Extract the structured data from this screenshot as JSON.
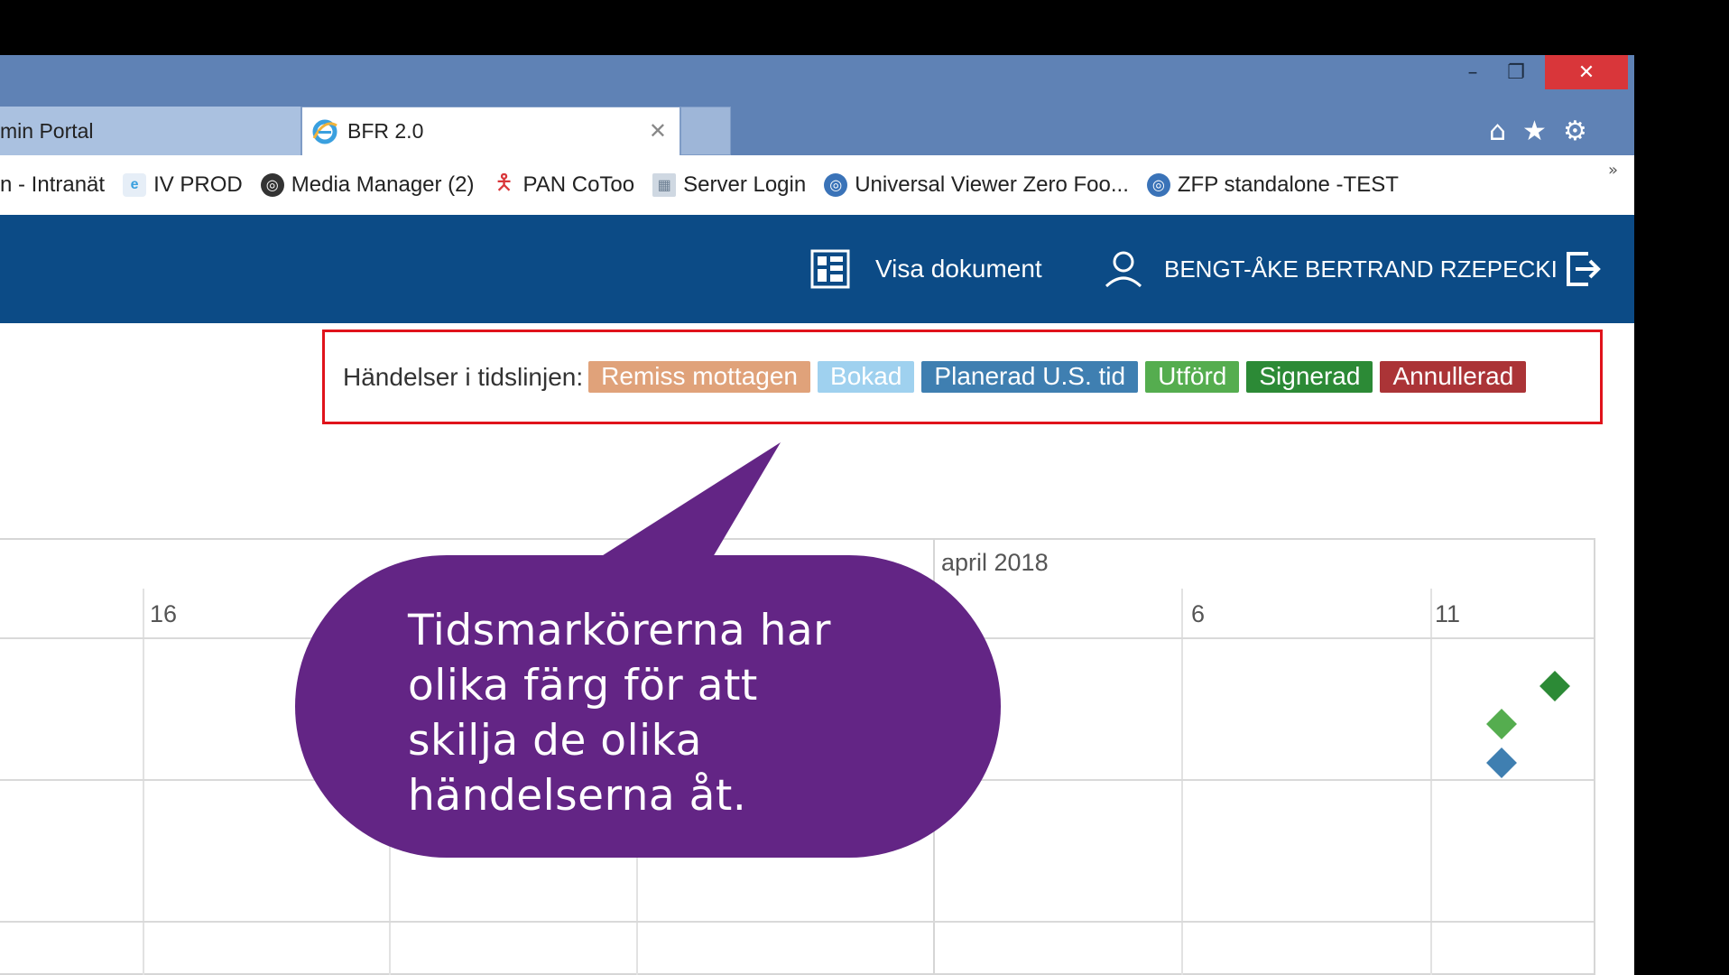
{
  "browser": {
    "tabs": [
      {
        "label": "min Portal",
        "active": false
      },
      {
        "label": "BFR 2.0",
        "active": true
      }
    ],
    "close_tab_glyph": "✕",
    "window_controls": {
      "minimize": "–",
      "restore": "❐",
      "close": "✕"
    },
    "toolbar_icons": {
      "home": "⌂",
      "favorites": "★",
      "settings": "⚙"
    },
    "favorites": [
      {
        "label": "n - Intranät",
        "icon": "none"
      },
      {
        "label": "IV PROD",
        "icon": "ie-icon"
      },
      {
        "label": "Media Manager (2)",
        "icon": "ge-icon"
      },
      {
        "label": "PAN CoToo",
        "icon": "person-icon"
      },
      {
        "label": "Server Login",
        "icon": "server-icon"
      },
      {
        "label": "Universal Viewer Zero Foo...",
        "icon": "ge-icon"
      },
      {
        "label": "ZFP standalone -TEST",
        "icon": "ge-icon"
      }
    ],
    "favorites_overflow": "»"
  },
  "app_header": {
    "view_documents": "Visa dokument",
    "user_name": "BENGT-ÅKE BERTRAND RZEPECKI"
  },
  "legend": {
    "label": "Händelser i tidslinjen:",
    "tags": [
      {
        "label": "Remiss mottagen",
        "color": "#e0a27a"
      },
      {
        "label": "Bokad",
        "color": "#9fd1ef"
      },
      {
        "label": "Planerad U.S. tid",
        "color": "#3f7fb1"
      },
      {
        "label": "Utförd",
        "color": "#55ad4f"
      },
      {
        "label": "Signerad",
        "color": "#2c8a36"
      },
      {
        "label": "Annullerad",
        "color": "#ab3437"
      }
    ]
  },
  "timeline": {
    "month_label": "april 2018",
    "day_ticks": [
      "16",
      "6",
      "11"
    ],
    "markers": [
      {
        "status": "Signerad",
        "color": "#2c8a36"
      },
      {
        "status": "Utförd",
        "color": "#55ad4f"
      },
      {
        "status": "Planerad U.S. tid",
        "color": "#3f7fb1"
      }
    ]
  },
  "callout": {
    "text_lines": [
      "Tidsmarkörerna har",
      "olika färg för att",
      "skilja de olika",
      "händelserna åt."
    ],
    "color": "#632585"
  }
}
